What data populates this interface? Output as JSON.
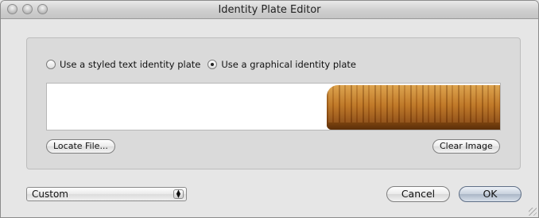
{
  "window": {
    "title": "Identity Plate Editor"
  },
  "options": {
    "styled_text_label": "Use a styled text identity plate",
    "graphical_label": "Use a graphical identity plate",
    "selected": "graphical"
  },
  "preview": {
    "image": "wood-plate-image"
  },
  "buttons": {
    "locate_file": "Locate File...",
    "clear_image": "Clear Image",
    "cancel": "Cancel",
    "ok": "OK"
  },
  "preset": {
    "selected": "Custom"
  },
  "colors": {
    "ok_button": "#b4c0d0",
    "wood": "#b8701f"
  }
}
